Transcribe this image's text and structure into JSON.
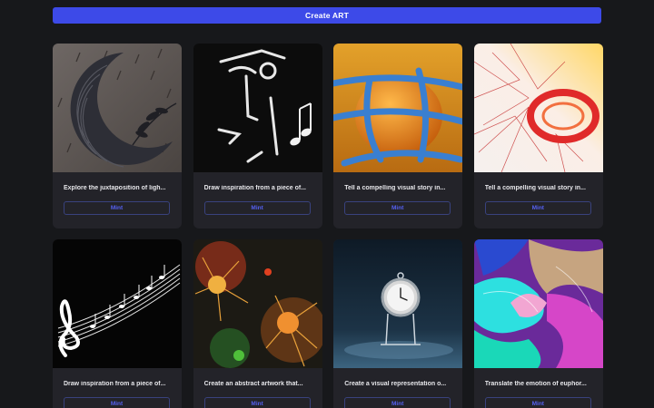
{
  "header": {
    "create_label": "Create ART"
  },
  "cards": [
    {
      "title": "Explore the juxtaposition of ligh...",
      "mint_label": "Mint",
      "art": "crescent-moon-leaves"
    },
    {
      "title": "Draw inspiration from a piece of...",
      "mint_label": "Mint",
      "art": "chalk-face-music-notes"
    },
    {
      "title": "Tell a compelling visual story in...",
      "mint_label": "Mint",
      "art": "orange-sphere-blue-bands"
    },
    {
      "title": "Tell a compelling visual story in...",
      "mint_label": "Mint",
      "art": "red-ring-threads"
    },
    {
      "title": "Draw inspiration from a piece of...",
      "mint_label": "Mint",
      "art": "treble-clef-staff"
    },
    {
      "title": "Create an abstract artwork that...",
      "mint_label": "Mint",
      "art": "neuron-splatter"
    },
    {
      "title": "Create a visual representation o...",
      "mint_label": "Mint",
      "art": "pocket-watch"
    },
    {
      "title": "Translate the emotion of euphor...",
      "mint_label": "Mint",
      "art": "fluid-swirl"
    }
  ]
}
